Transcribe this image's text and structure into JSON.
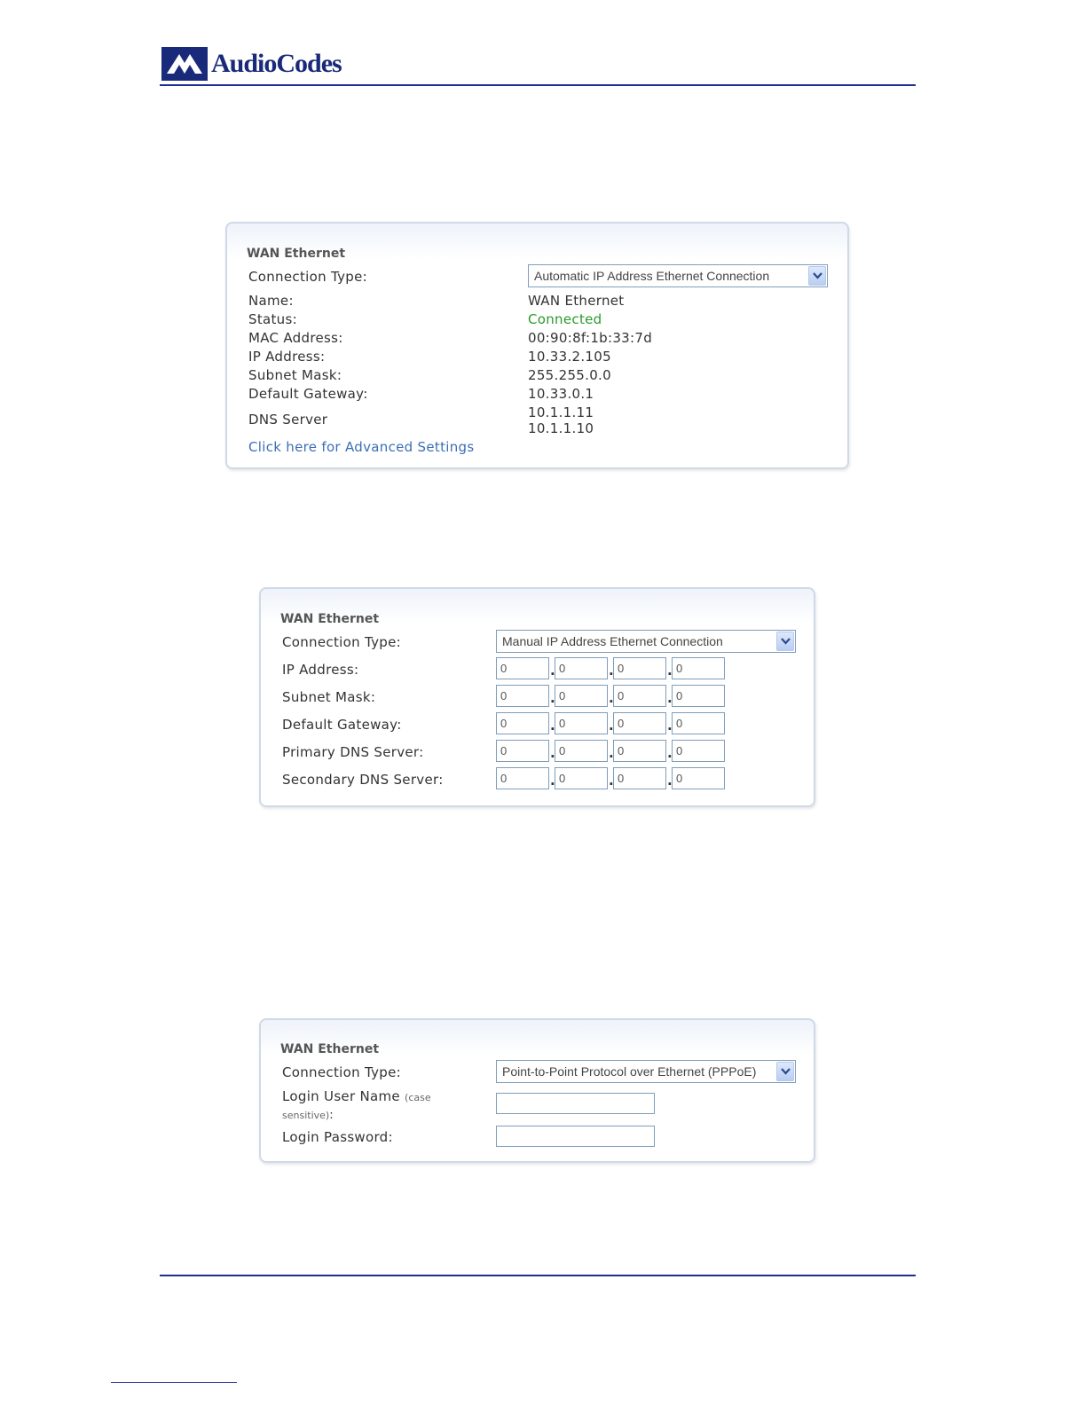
{
  "header": {
    "logo_text": "AudioCodes",
    "brand_color": "#1f2f8f"
  },
  "panel_auto": {
    "title": "WAN Ethernet",
    "connection_type_label": "Connection Type:",
    "connection_type_value": "Automatic IP Address Ethernet Connection",
    "rows": [
      {
        "label": "Name:",
        "value": "WAN Ethernet"
      },
      {
        "label": "Status:",
        "value": "Connected"
      },
      {
        "label": "MAC Address:",
        "value": "00:90:8f:1b:33:7d"
      },
      {
        "label": "IP Address:",
        "value": "10.33.2.105"
      },
      {
        "label": "Subnet Mask:",
        "value": "255.255.0.0"
      },
      {
        "label": "Default Gateway:",
        "value": "10.33.0.1"
      }
    ],
    "dns_label": "DNS Server",
    "dns_values": [
      "10.1.1.11",
      "10.1.1.10"
    ],
    "advanced_link": "Click here for Advanced Settings",
    "status_color": "#2a9a2a"
  },
  "panel_manual": {
    "title": "WAN Ethernet",
    "connection_type_label": "Connection Type:",
    "connection_type_value": "Manual IP Address Ethernet Connection",
    "fields": [
      {
        "label": "IP Address:",
        "octets": [
          "0",
          "0",
          "0",
          "0"
        ]
      },
      {
        "label": "Subnet Mask:",
        "octets": [
          "0",
          "0",
          "0",
          "0"
        ]
      },
      {
        "label": "Default Gateway:",
        "octets": [
          "0",
          "0",
          "0",
          "0"
        ]
      },
      {
        "label": "Primary DNS Server:",
        "octets": [
          "0",
          "0",
          "0",
          "0"
        ]
      },
      {
        "label": "Secondary DNS Server:",
        "octets": [
          "0",
          "0",
          "0",
          "0"
        ]
      }
    ]
  },
  "panel_pppoe": {
    "title": "WAN Ethernet",
    "connection_type_label": "Connection Type:",
    "connection_type_value": "Point-to-Point Protocol over Ethernet (PPPoE)",
    "login_user_label": "Login User Name",
    "login_user_hint_1": "(case",
    "login_user_hint_2": "sensitive)",
    "login_user_colon": ":",
    "login_user_value": "",
    "login_password_label": "Login Password:",
    "login_password_value": ""
  }
}
